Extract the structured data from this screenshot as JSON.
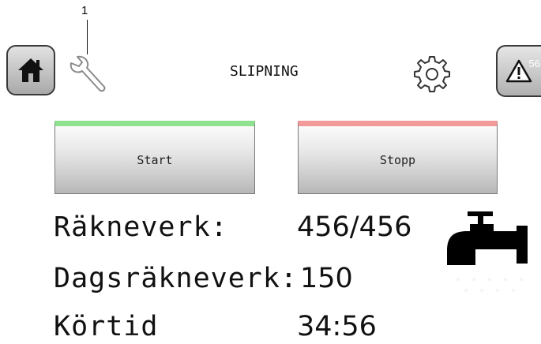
{
  "callout": {
    "number": "1"
  },
  "header": {
    "title": "SLIPNING",
    "alarm_count": "56",
    "icons": {
      "home": "home-icon",
      "wrench": "wrench-icon",
      "gear": "gear-icon",
      "alarm": "warning-icon"
    }
  },
  "controls": {
    "start_label": "Start",
    "stop_label": "Stopp",
    "start_accent": "#8fe08f",
    "stop_accent": "#f29a9a"
  },
  "readouts": [
    {
      "label": "Räkneverk:",
      "value": "456/456"
    },
    {
      "label": "Dagsräkneverk:",
      "value": "150"
    },
    {
      "label": "Körtid",
      "value": "34:56"
    }
  ],
  "status_icon": "water-tap-icon"
}
